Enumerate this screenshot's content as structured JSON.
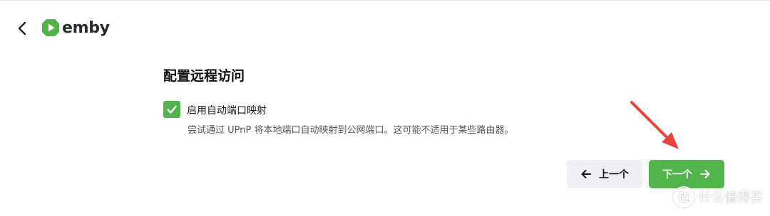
{
  "header": {
    "logo_text": "emby",
    "brand_color": "#52b54b"
  },
  "page": {
    "title": "配置远程访问"
  },
  "upnp": {
    "checked": true,
    "label": "启用自动端口映射",
    "description": "尝试通过 UPnP 将本地端口自动映射到公网端口。这可能不适用于某些路由器。"
  },
  "buttons": {
    "prev_label": "上一个",
    "next_label": "下一个"
  },
  "watermark": {
    "badge": "值",
    "text": "什么值得买"
  },
  "annotation": {
    "arrow_color": "#e8453c"
  },
  "icons": [
    "chevron-left-icon",
    "emby-logo-icon",
    "check-icon",
    "arrow-left-icon",
    "arrow-right-icon"
  ]
}
